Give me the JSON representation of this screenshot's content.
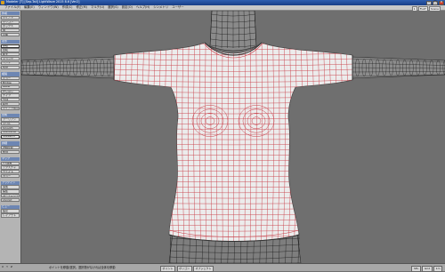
{
  "window": {
    "title": "Modeler [T] [Sep-Tail] LightWave 2015 8.6 [Ver2]"
  },
  "menubar": {
    "items": [
      "ファイル(F)",
      "編集(E)",
      "ウィンドウ(W)",
      "作成(C)",
      "修正(M)",
      "マルチ(U)",
      "選択(S)",
      "設定(O)",
      "ヘルプ(H)",
      "シンメトリ",
      "ユーザー"
    ]
  },
  "top_controls": {
    "layer": "1",
    "view": "FLAT",
    "mode": "Scene"
  },
  "sidebar": {
    "items": [
      {
        "label": "作成",
        "kind": "header"
      },
      {
        "label": "ポイント",
        "kind": "button"
      },
      {
        "label": "ポリゴン",
        "kind": "button"
      },
      {
        "label": "ボックス",
        "kind": "button"
      },
      {
        "label": "球",
        "kind": "button"
      },
      {
        "label": "円盤",
        "kind": "button"
      },
      {
        "label": "変形",
        "kind": "header"
      },
      {
        "label": "移動",
        "kind": "active"
      },
      {
        "label": "回転",
        "kind": "button"
      },
      {
        "label": "拡大",
        "kind": "button"
      },
      {
        "label": "ドラッグ",
        "kind": "button"
      },
      {
        "label": "ベンド",
        "kind": "button"
      },
      {
        "label": "削除",
        "kind": "button"
      },
      {
        "label": "複製",
        "kind": "header"
      },
      {
        "label": "ミラー",
        "kind": "button"
      },
      {
        "label": "Bridge",
        "kind": "button"
      },
      {
        "label": "Bevel",
        "kind": "button"
      },
      {
        "label": "押し出し",
        "kind": "button"
      },
      {
        "label": "ナイフ",
        "kind": "button"
      },
      {
        "label": "分割",
        "kind": "button"
      },
      {
        "label": "結合",
        "kind": "button"
      },
      {
        "label": "ポイント結合",
        "kind": "button"
      },
      {
        "label": "合成",
        "kind": "header"
      },
      {
        "label": "ブーリアン",
        "kind": "button"
      },
      {
        "label": "ドリル",
        "kind": "button"
      },
      {
        "label": "Smooth",
        "kind": "button"
      },
      {
        "label": "Subdivide",
        "kind": "button"
      },
      {
        "label": "SubPatch",
        "kind": "active"
      },
      {
        "label": "詳細",
        "kind": "header"
      },
      {
        "label": "法線反転",
        "kind": "button"
      },
      {
        "label": "整列",
        "kind": "button"
      },
      {
        "label": "マップ",
        "kind": "header"
      },
      {
        "label": "UV展開",
        "kind": "button"
      },
      {
        "label": "テクスチャ",
        "kind": "button"
      },
      {
        "label": "ウェイト",
        "kind": "button"
      },
      {
        "label": "カラー",
        "kind": "button"
      },
      {
        "label": "プラグイン",
        "kind": "header"
      },
      {
        "label": "追加",
        "kind": "button"
      },
      {
        "label": "編集",
        "kind": "button"
      },
      {
        "label": "ユーティリティ",
        "kind": "button"
      },
      {
        "label": "LScript",
        "kind": "button"
      },
      {
        "label": "ビュー",
        "kind": "header"
      },
      {
        "label": "設定",
        "kind": "button"
      },
      {
        "label": "レイアウト",
        "kind": "button"
      }
    ]
  },
  "statusbar": {
    "coords": [
      "X",
      "Y",
      "Z"
    ],
    "message": "ポイントを移動/選択。選択物がなければ全体を移動",
    "grid_buttons": [
      "ポイント",
      "ポリゴン",
      "オブジェクト"
    ],
    "right_tools": [
      "SEL",
      "Grid",
      "1m"
    ]
  },
  "colors": {
    "viewport_bg": "#6f6f6f",
    "wire_dark": "#1a1a1a",
    "wire_red": "#c8404a",
    "shirt_fill": "#ececec"
  }
}
